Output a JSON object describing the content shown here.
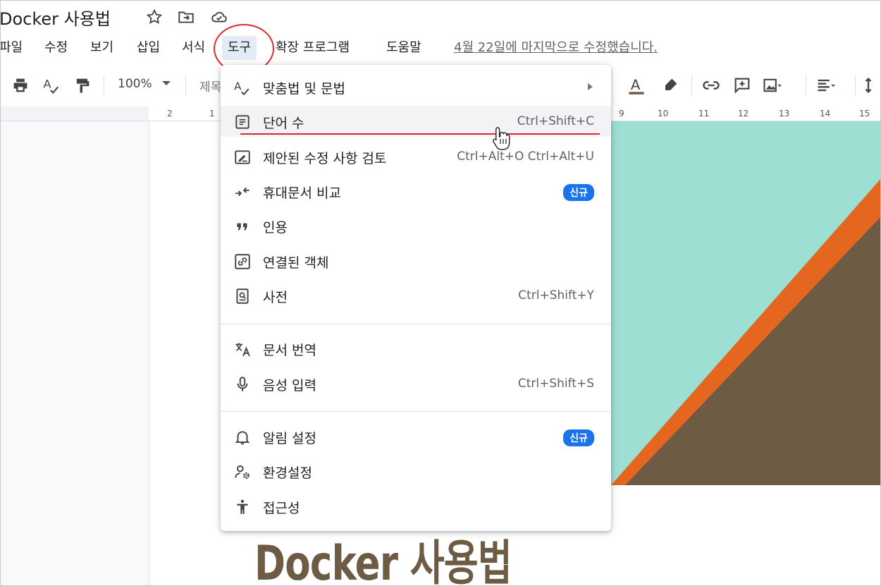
{
  "doc": {
    "title": "Docker 사용법",
    "last_edit": "4월 22일에 마지막으로 수정했습니다.",
    "body_title": "Docker 사용법"
  },
  "menu": {
    "file": "파일",
    "edit": "수정",
    "view": "보기",
    "insert": "삽입",
    "format": "서식",
    "tools": "도구",
    "extensions": "확장 프로그램",
    "help": "도움말"
  },
  "toolbar": {
    "zoom": "100%",
    "style_partial": "제목"
  },
  "ruler": {
    "left": [
      "2",
      "1"
    ],
    "right": [
      "9",
      "10",
      "11",
      "12",
      "13",
      "14",
      "15"
    ]
  },
  "tools_menu": {
    "items": [
      {
        "label": "맞춤법 및 문법",
        "shortcut": "",
        "icon": "spellcheck-icon",
        "submenu": true
      },
      {
        "label": "단어 수",
        "shortcut": "Ctrl+Shift+C",
        "icon": "word-count-icon"
      },
      {
        "label": "제안된 수정 사항 검토",
        "shortcut": "Ctrl+Alt+O Ctrl+Alt+U",
        "icon": "review-edits-icon"
      },
      {
        "label": "휴대문서 비교",
        "badge": "신규",
        "icon": "compare-icon"
      },
      {
        "label": "인용",
        "shortcut": "",
        "icon": "quote-icon"
      },
      {
        "label": "연결된 객체",
        "shortcut": "",
        "icon": "linked-object-icon"
      },
      {
        "label": "사전",
        "shortcut": "Ctrl+Shift+Y",
        "icon": "dictionary-icon"
      },
      {
        "label": "문서 번역",
        "shortcut": "",
        "icon": "translate-icon"
      },
      {
        "label": "음성 입력",
        "shortcut": "Ctrl+Shift+S",
        "icon": "microphone-icon"
      },
      {
        "label": "알림 설정",
        "badge": "신규",
        "icon": "bell-icon"
      },
      {
        "label": "환경설정",
        "shortcut": "",
        "icon": "preferences-icon"
      },
      {
        "label": "접근성",
        "shortcut": "",
        "icon": "accessibility-icon"
      }
    ]
  },
  "colors": {
    "annotation_red": "#e0262c",
    "badge_blue": "#1a73e8",
    "cover_teal": "#9ddfd3",
    "cover_orange": "#e5661f",
    "cover_brown": "#6e5b44"
  }
}
